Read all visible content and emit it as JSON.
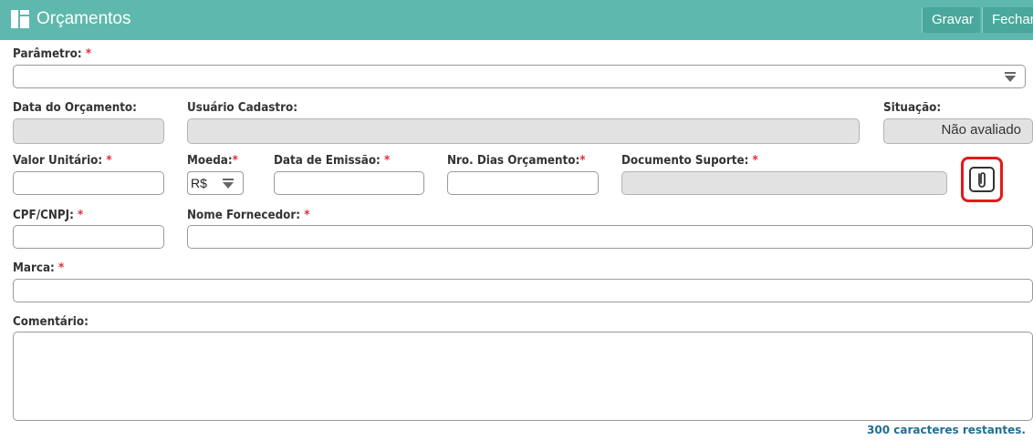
{
  "header": {
    "title": "Orçamentos",
    "icon": "grid-icon",
    "save_label": "Gravar",
    "close_label": "Fechar"
  },
  "form": {
    "parametro": {
      "label": "Parâmetro:",
      "required": "*",
      "value": ""
    },
    "data_orcamento": {
      "label": "Data do Orçamento:",
      "value": ""
    },
    "usuario_cadastro": {
      "label": "Usuário Cadastro:",
      "value": ""
    },
    "situacao": {
      "label": "Situação:",
      "value": "Não avaliado"
    },
    "valor_unitario": {
      "label": "Valor Unitário:",
      "required": "*",
      "value": ""
    },
    "moeda": {
      "label": "Moeda:",
      "required": "*",
      "value": "R$"
    },
    "data_emissao": {
      "label": "Data de Emissão:",
      "required": "*",
      "value": ""
    },
    "nro_dias": {
      "label": "Nro. Dias Orçamento:",
      "required": "*",
      "value": ""
    },
    "documento_suporte": {
      "label": "Documento Suporte:",
      "required": "*",
      "value": "",
      "attach_icon": "paperclip-icon"
    },
    "cpf_cnpj": {
      "label": "CPF/CNPJ:",
      "required": "*",
      "value": ""
    },
    "nome_fornecedor": {
      "label": "Nome Fornecedor:",
      "required": "*",
      "value": ""
    },
    "marca": {
      "label": "Marca:",
      "required": "*",
      "value": ""
    },
    "comentario": {
      "label": "Comentário:",
      "value": "",
      "counter": "300 caracteres restantes."
    }
  },
  "colors": {
    "header": "#5fb8ad",
    "button": "#4aa79c",
    "required": "#e0303a",
    "highlight": "#e41a1a",
    "counter": "#1f6f92"
  }
}
